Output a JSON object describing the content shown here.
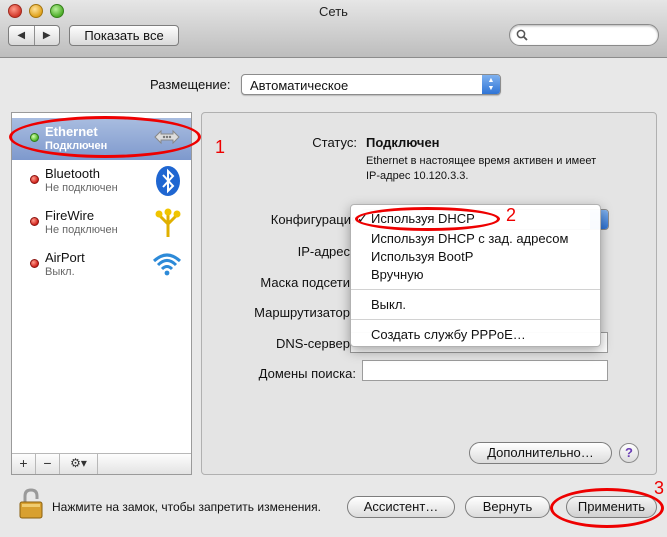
{
  "window": {
    "title": "Сеть"
  },
  "toolbar": {
    "back_glyph": "◀",
    "forward_glyph": "▶",
    "show_all": "Показать все",
    "search_placeholder": ""
  },
  "location": {
    "label": "Размещение:",
    "value": "Автоматическое"
  },
  "services": [
    {
      "name": "Ethernet",
      "status": "Подключен",
      "selected": true,
      "dot": "green",
      "icon": "ethernet-icon"
    },
    {
      "name": "Bluetooth",
      "status": "Не подключен",
      "selected": false,
      "dot": "red",
      "icon": "bluetooth-icon"
    },
    {
      "name": "FireWire",
      "status": "Не подключен",
      "selected": false,
      "dot": "red",
      "icon": "firewire-icon"
    },
    {
      "name": "AirPort",
      "status": "Выкл.",
      "selected": false,
      "dot": "red",
      "icon": "airport-icon"
    }
  ],
  "sidebar_toolbar": {
    "add": "+",
    "remove": "−",
    "action": "⚙▾"
  },
  "detail": {
    "status_label": "Статус:",
    "status_value": "Подключен",
    "status_desc": "Ethernet в настоящее время активен и имеет IP-адрес 10.120.3.3.",
    "config_label": "Конфигурация",
    "ip_label": "IP-адрес",
    "mask_label": "Маска подсети",
    "router_label": "Маршрутизатор",
    "dns_label": "DNS-сервер",
    "search_domains_label": "Домены поиска:",
    "advanced_button": "Дополнительно…",
    "help": "?"
  },
  "config_menu": {
    "checkmark": "✓",
    "items": [
      "Используя DHCP",
      "Используя DHCP с зад. адресом",
      "Используя BootP",
      "Вручную",
      "Выкл.",
      "Создать службу PPPoE…"
    ]
  },
  "bottom": {
    "lock_text": "Нажмите на замок, чтобы запретить изменения.",
    "assistant": "Ассистент…",
    "revert": "Вернуть",
    "apply": "Применить"
  },
  "annotations": {
    "n1": "1",
    "n2": "2",
    "n3": "3",
    "color": "#e00000"
  }
}
